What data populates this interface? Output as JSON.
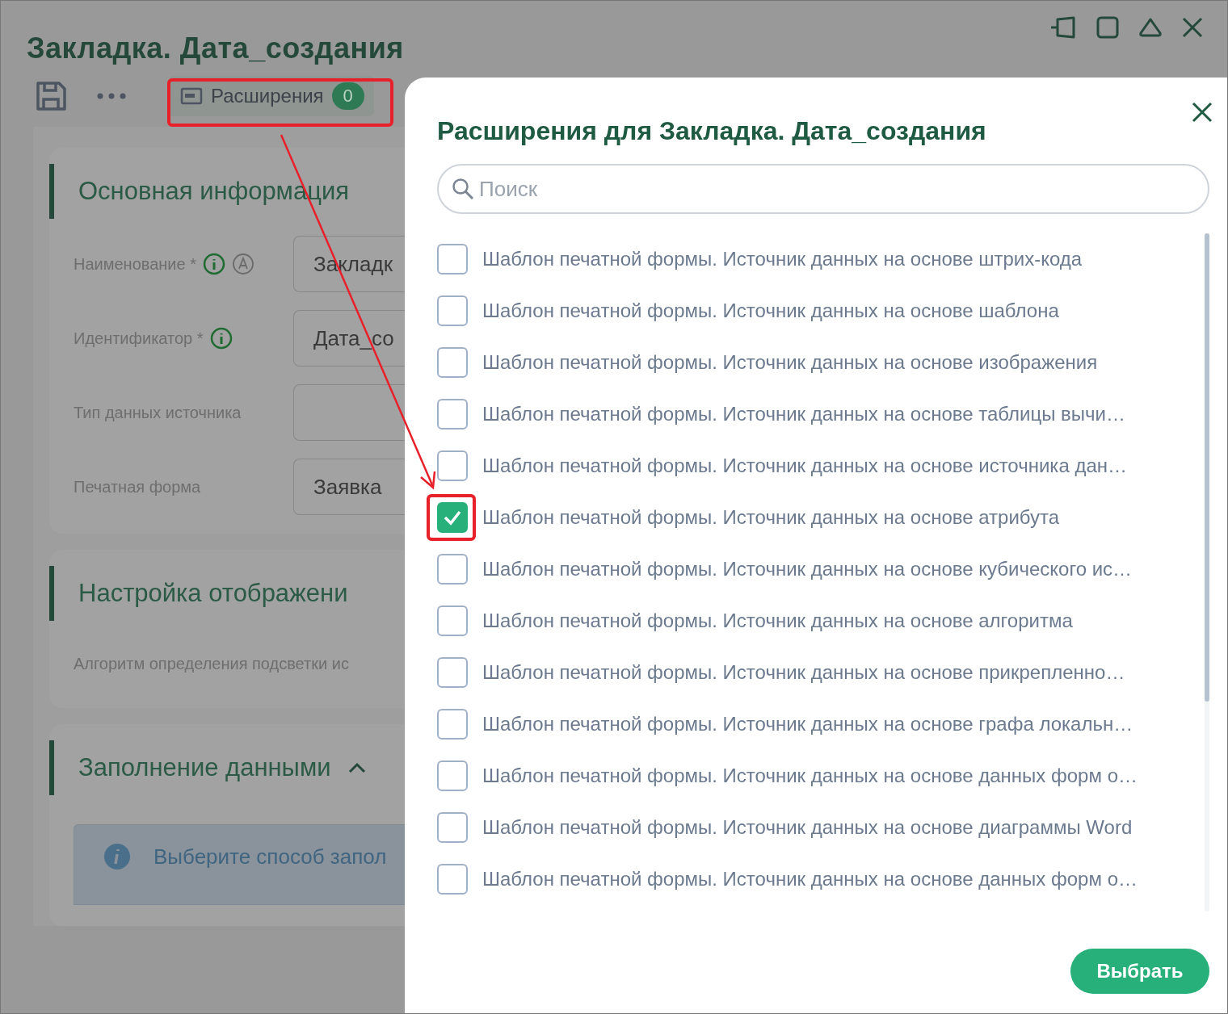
{
  "window": {
    "title": "Закладка. Дата_создания"
  },
  "toolbar": {
    "extensions_button": {
      "label": "Расширения",
      "count": "0"
    }
  },
  "sections": [
    {
      "kind": "form",
      "title": "Основная информация",
      "fields": [
        {
          "label": "Наименование *",
          "value": "Закладк",
          "info": true,
          "auto": true
        },
        {
          "label": "Идентификатор *",
          "value": "Дата_со",
          "info": true,
          "auto": false
        },
        {
          "label": "Тип данных источника",
          "info": false,
          "auto": false
        },
        {
          "label": "Печатная форма",
          "value": "Заявка",
          "info": false,
          "auto": false
        }
      ]
    },
    {
      "kind": "text",
      "title": "Настройка отображени",
      "text": "Алгоритм определения подсветки ис"
    },
    {
      "kind": "notice",
      "title": "Заполнение данными",
      "expanded": true,
      "notice": "Выберите способ запол"
    }
  ],
  "drawer": {
    "title": "Расширения для Закладка. Дата_создания",
    "search": {
      "placeholder": "Поиск"
    },
    "items": [
      {
        "label": "Шаблон печатной формы. Источник данных на основе штрих-кода",
        "checked": false
      },
      {
        "label": "Шаблон печатной формы. Источник данных на основе шаблона",
        "checked": false
      },
      {
        "label": "Шаблон печатной формы. Источник данных на основе изображения",
        "checked": false
      },
      {
        "label": "Шаблон печатной формы. Источник данных на основе таблицы вычи…",
        "checked": false
      },
      {
        "label": "Шаблон печатной формы. Источник данных на основе источника дан…",
        "checked": false
      },
      {
        "label": "Шаблон печатной формы. Источник данных на основе атрибута",
        "checked": true
      },
      {
        "label": "Шаблон печатной формы. Источник данных на основе кубического ис…",
        "checked": false
      },
      {
        "label": "Шаблон печатной формы. Источник данных на основе алгоритма",
        "checked": false
      },
      {
        "label": "Шаблон печатной формы. Источник данных на основе прикрепленно…",
        "checked": false
      },
      {
        "label": "Шаблон печатной формы. Источник данных на основе графа локальн…",
        "checked": false
      },
      {
        "label": "Шаблон печатной формы. Источник данных на основе данных форм о…",
        "checked": false
      },
      {
        "label": "Шаблон печатной формы. Источник данных на основе диаграммы Word",
        "checked": false
      },
      {
        "label": "Шаблон печатной формы. Источник данных на основе данных форм о…",
        "checked": false
      }
    ],
    "confirm_button": "Выбрать"
  }
}
